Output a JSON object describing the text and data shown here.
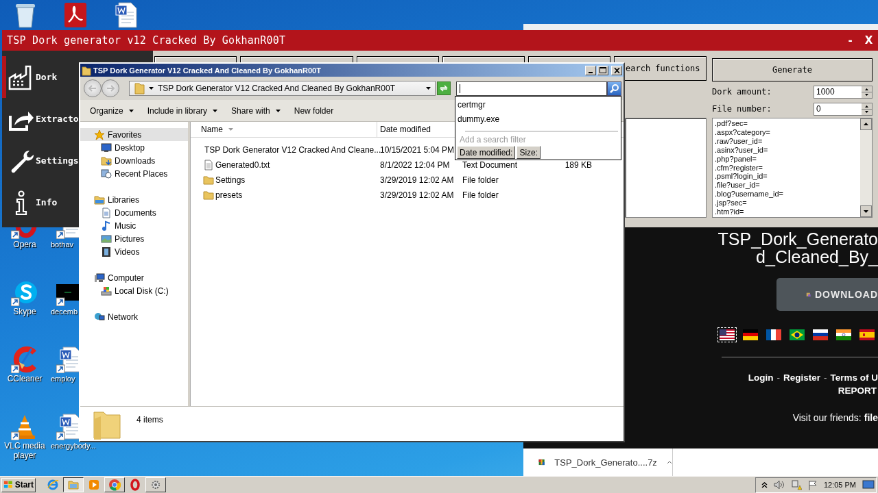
{
  "desktop": {
    "top_icons": [
      {
        "kind": "bin"
      },
      {
        "kind": "pdf"
      },
      {
        "kind": "word"
      }
    ],
    "icons": [
      {
        "label": "Opera",
        "kind": "opera"
      },
      {
        "label": "bothav",
        "kind": "word"
      },
      {
        "label": "Skype",
        "kind": "skype"
      },
      {
        "label": "decemb",
        "kind": "video"
      },
      {
        "label": "CCleaner",
        "kind": "ccleaner"
      },
      {
        "label": "employ",
        "kind": "word"
      },
      {
        "label": "VLC media player",
        "kind": "vlc"
      },
      {
        "label": "energybody...",
        "kind": "word"
      }
    ]
  },
  "browser": {
    "heading_lines": [
      "TSP_Dork_Generato",
      "d_Cleaned_By_"
    ],
    "download_button": "DOWNLOAD",
    "flags": [
      {
        "kind": "us",
        "selected": true
      },
      {
        "kind": "de",
        "selected": false
      },
      {
        "kind": "fr",
        "selected": false
      },
      {
        "kind": "br",
        "selected": false
      },
      {
        "kind": "ru",
        "selected": false
      },
      {
        "kind": "in",
        "selected": false
      },
      {
        "kind": "es",
        "selected": false
      }
    ],
    "footer_links": [
      "Login",
      "Register",
      "Terms of U"
    ],
    "separator": "-",
    "report": "REPORT",
    "friends_label": "Visit our friends:",
    "friends_link": "file",
    "download_item": "TSP_Dork_Generato....7z"
  },
  "tsp_app": {
    "title": "TSP Dork generator v12 Cracked By GokhanR00T",
    "window_buttons": [
      "-",
      "X"
    ],
    "nav": [
      {
        "label": "Dork",
        "kind": "factory",
        "selected": true
      },
      {
        "label": "Extracto",
        "kind": "share",
        "selected": false
      },
      {
        "label": "Settings",
        "kind": "wrench",
        "selected": false
      },
      {
        "label": "Info",
        "kind": "info",
        "selected": false
      }
    ],
    "function_button": "earch functions",
    "generate_button": "Generate",
    "dork_amount": {
      "label": "Dork amount:",
      "value": "1000"
    },
    "file_number": {
      "label": "File number:",
      "value": "0"
    },
    "output_lines": [
      ".pdf?sec=",
      ".aspx?category=",
      ".raw?user_id=",
      ".asinx?user_id=",
      ".php?panel=",
      ".cfm?register=",
      ".psml?login_id=",
      ".file?user_id=",
      ".blog?username_id=",
      ".jsp?sec=",
      ".htm?id="
    ]
  },
  "explorer": {
    "title": "TSP Dork Generator V12 Cracked And Cleaned By GokhanR00T",
    "address": "TSP Dork Generator V12 Cracked And Cleaned By GokhanR00T",
    "toolbar": [
      {
        "label": "Organize",
        "menu": true
      },
      {
        "label": "Include in library",
        "menu": true
      },
      {
        "label": "Share with",
        "menu": true
      },
      {
        "label": "New folder",
        "menu": false
      }
    ],
    "nav": [
      {
        "label": "Favorites",
        "kind": "star",
        "selected": true,
        "children": [
          {
            "label": "Desktop",
            "kind": "desktop",
            "selected": false
          },
          {
            "label": "Downloads",
            "kind": "downloads",
            "selected": false
          },
          {
            "label": "Recent Places",
            "kind": "recent",
            "selected": false
          }
        ]
      },
      {
        "label": "Libraries",
        "kind": "library",
        "selected": false,
        "children": [
          {
            "label": "Documents",
            "kind": "documents",
            "selected": false
          },
          {
            "label": "Music",
            "kind": "music",
            "selected": false
          },
          {
            "label": "Pictures",
            "kind": "pictures",
            "selected": false
          },
          {
            "label": "Videos",
            "kind": "videos",
            "selected": false
          }
        ]
      },
      {
        "label": "Computer",
        "kind": "computer",
        "selected": false,
        "children": [
          {
            "label": "Local Disk (C:)",
            "kind": "disk",
            "selected": false
          }
        ]
      },
      {
        "label": "Network",
        "kind": "network",
        "selected": false
      }
    ],
    "columns": [
      "Name",
      "Date modified"
    ],
    "rows": [
      {
        "kind": "app",
        "name": "TSP Dork Generator V12 Cracked And Cleane...",
        "date": "10/15/2021 5:04 PM"
      },
      {
        "kind": "text",
        "name": "Generated0.txt",
        "date": "8/1/2022 12:04 PM",
        "type": "Text Document",
        "size": "189 KB"
      },
      {
        "kind": "folder",
        "name": "Settings",
        "date": "3/29/2019 12:02 AM",
        "type": "File folder"
      },
      {
        "kind": "folder",
        "name": "presets",
        "date": "3/29/2019 12:02 AM",
        "type": "File folder"
      }
    ],
    "search_popup": {
      "suggestions": [
        "certmgr",
        "dummy.exe"
      ],
      "filter_hint": "Add a search filter",
      "filters": [
        "Date modified:",
        "Size:"
      ]
    },
    "status": "4 items"
  },
  "taskbar": {
    "start": "Start",
    "apps": [
      {
        "kind": "ie",
        "running": false,
        "selected": false
      },
      {
        "kind": "explorer",
        "running": true,
        "selected": true
      },
      {
        "kind": "media",
        "running": false,
        "selected": false
      },
      {
        "kind": "chrome",
        "running": true,
        "selected": false
      },
      {
        "kind": "opera",
        "running": false,
        "selected": false
      },
      {
        "kind": "app",
        "running": true,
        "selected": false
      }
    ],
    "clock": "12:05 PM"
  }
}
